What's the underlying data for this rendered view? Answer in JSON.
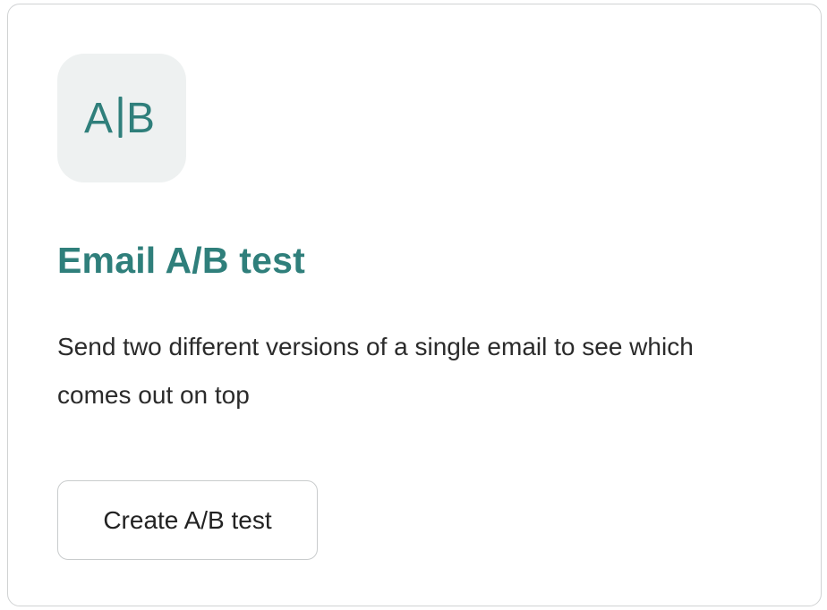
{
  "card": {
    "icon": {
      "name": "ab-test-icon",
      "glyph_left": "A",
      "glyph_right": "B",
      "color": "#2f7f7b",
      "background": "#eef1f1"
    },
    "title": "Email A/B test",
    "description": "Send two different versions of a single email to see which comes out on top",
    "button_label": "Create A/B test"
  },
  "colors": {
    "accent": "#2f7f7b",
    "text": "#2b2b2b",
    "border": "#d0d2d3"
  }
}
